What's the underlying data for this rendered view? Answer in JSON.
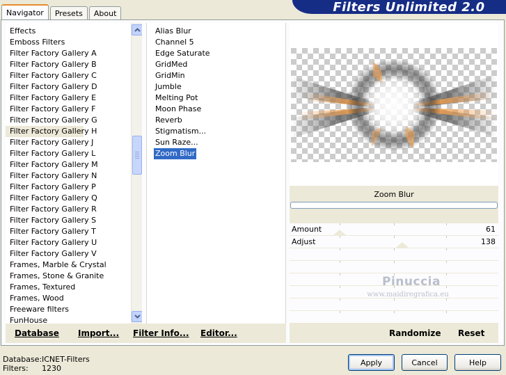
{
  "tabs": [
    "Navigator",
    "Presets",
    "About"
  ],
  "banner_title": "Filters Unlimited 2.0",
  "categories": [
    "Effects",
    "Emboss Filters",
    "Filter Factory Gallery A",
    "Filter Factory Gallery B",
    "Filter Factory Gallery C",
    "Filter Factory Gallery D",
    "Filter Factory Gallery E",
    "Filter Factory Gallery F",
    "Filter Factory Gallery G",
    "Filter Factory Gallery H",
    "Filter Factory Gallery J",
    "Filter Factory Gallery L",
    "Filter Factory Gallery M",
    "Filter Factory Gallery N",
    "Filter Factory Gallery P",
    "Filter Factory Gallery Q",
    "Filter Factory Gallery R",
    "Filter Factory Gallery S",
    "Filter Factory Gallery T",
    "Filter Factory Gallery U",
    "Filter Factory Gallery V",
    "Frames, Marble & Crystal",
    "Frames, Stone & Granite",
    "Frames, Textured",
    "Frames, Wood",
    "Freeware filters",
    "FunHouse"
  ],
  "selected_category": "Filter Factory Gallery H",
  "filters": [
    "Alias Blur",
    "Channel 5",
    "Edge Saturate",
    "GridMed",
    "GridMin",
    "Jumble",
    "Melting Pot",
    "Moon Phase",
    "Reverb",
    "Stigmatism...",
    "Sun Raze...",
    "Zoom Blur"
  ],
  "selected_filter": "Zoom Blur",
  "bottom_links": {
    "database": "Database",
    "import": "Import...",
    "filter_info": "Filter Info...",
    "editor": "Editor..."
  },
  "filter_name": "Zoom Blur",
  "progress": 0,
  "params": [
    {
      "label": "Amount",
      "value": "61",
      "fraction": 0.24
    },
    {
      "label": "Adjust",
      "value": "138",
      "fraction": 0.54
    }
  ],
  "watermark": {
    "name": "Pinuccia",
    "site": "www.maidiregrafica.eu"
  },
  "right_links": {
    "randomize": "Randomize",
    "reset": "Reset"
  },
  "info": {
    "database_label": "Database:",
    "database_value": "ICNET-Filters",
    "filters_label": "Filters:",
    "filters_value": "1230"
  },
  "buttons": {
    "apply": "Apply",
    "cancel": "Cancel",
    "help": "Help"
  },
  "colors": {
    "selection": "#316ac5",
    "banner": "#162d86",
    "accent": "#e68b2c",
    "ray": "#f0a050"
  }
}
